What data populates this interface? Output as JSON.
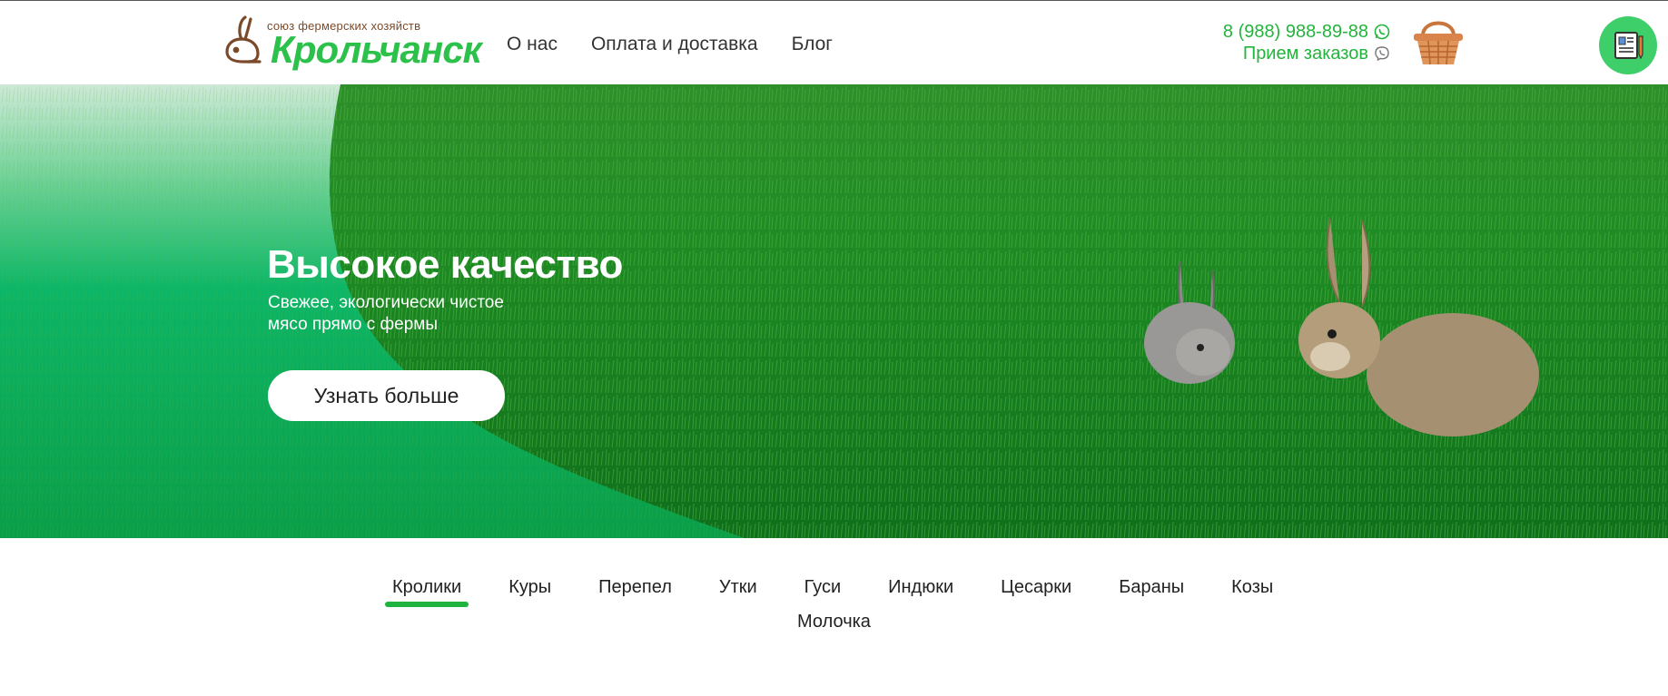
{
  "header": {
    "logo": {
      "tagline": "союз фермерских хозяйств",
      "name": "Крольчанск",
      "icon": "rabbit-logo-icon"
    },
    "nav": [
      {
        "label": "О нас"
      },
      {
        "label": "Оплата и доставка"
      },
      {
        "label": "Блог"
      }
    ],
    "contacts": {
      "phone": "8 (988) 988-89-88",
      "phone_icon": "whatsapp-icon",
      "orders": "Прием заказов",
      "orders_icon": "viber-icon"
    },
    "basket_icon": "basket-icon",
    "profile_icon": "document-icon"
  },
  "hero": {
    "title": "Высокое качество",
    "subtitle_line1": "Свежее, экологически чистое",
    "subtitle_line2": "мясо прямо с фермы",
    "button": "Узнать больше"
  },
  "categories": {
    "active_index": 0,
    "items": [
      "Кролики",
      "Куры",
      "Перепел",
      "Утки",
      "Гуси",
      "Индюки",
      "Цесарки",
      "Бараны",
      "Козы",
      "Молочка"
    ]
  },
  "colors": {
    "brand_green": "#23b43c",
    "logo_brown": "#7a4a2a",
    "accent_green": "#1fb43f"
  }
}
